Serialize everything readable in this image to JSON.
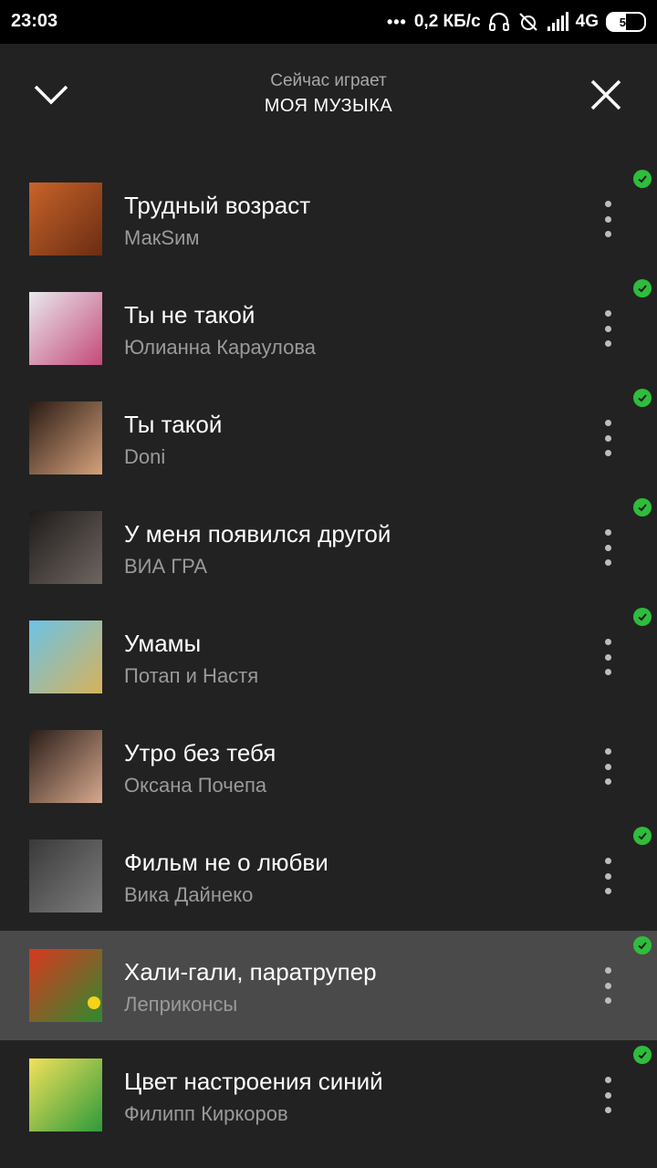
{
  "status": {
    "time": "23:03",
    "net_speed": "0,2 КБ/с",
    "network": "4G",
    "battery": "50"
  },
  "header": {
    "subtitle": "Сейчас играет",
    "title": "МОЯ МУЗЫКА"
  },
  "tracks": [
    {
      "title": "Трудный возраст",
      "artist": "МакSим",
      "downloaded": true,
      "active": false,
      "cover_colors": [
        "#c8632a",
        "#6a2d12"
      ]
    },
    {
      "title": "Ты не такой",
      "artist": "Юлианна Караулова",
      "downloaded": true,
      "active": false,
      "cover_colors": [
        "#e9e9ee",
        "#c44a7a"
      ]
    },
    {
      "title": "Ты такой",
      "artist": "Doni",
      "downloaded": true,
      "active": false,
      "cover_colors": [
        "#2a1a14",
        "#d5a27b"
      ]
    },
    {
      "title": "У меня появился другой",
      "artist": "ВИА ГРА",
      "downloaded": true,
      "active": false,
      "cover_colors": [
        "#1f1b1a",
        "#6e6560"
      ]
    },
    {
      "title": "Умамы",
      "artist": "Потап и Настя",
      "downloaded": true,
      "active": false,
      "cover_colors": [
        "#6cc3e6",
        "#d7b25a"
      ]
    },
    {
      "title": "Утро без тебя",
      "artist": "Оксана Почепа",
      "downloaded": false,
      "active": false,
      "cover_colors": [
        "#2a1d18",
        "#d7a88d"
      ]
    },
    {
      "title": "Фильм не о любви",
      "artist": "Вика Дайнеко",
      "downloaded": true,
      "active": false,
      "cover_colors": [
        "#3a3a3a",
        "#7d7d7d"
      ]
    },
    {
      "title": "Хали-гали, паратрупер",
      "artist": "Леприконсы",
      "downloaded": true,
      "active": true,
      "cover_colors": [
        "#d8381f",
        "#2f8a2f"
      ]
    },
    {
      "title": "Цвет настроения синий",
      "artist": "Филипп Киркоров",
      "downloaded": true,
      "active": false,
      "cover_colors": [
        "#f2e15a",
        "#2e9a3b"
      ]
    }
  ],
  "colors": {
    "background": "#222222",
    "active_row": "#4a4a4a",
    "check": "#2ebd3c"
  }
}
